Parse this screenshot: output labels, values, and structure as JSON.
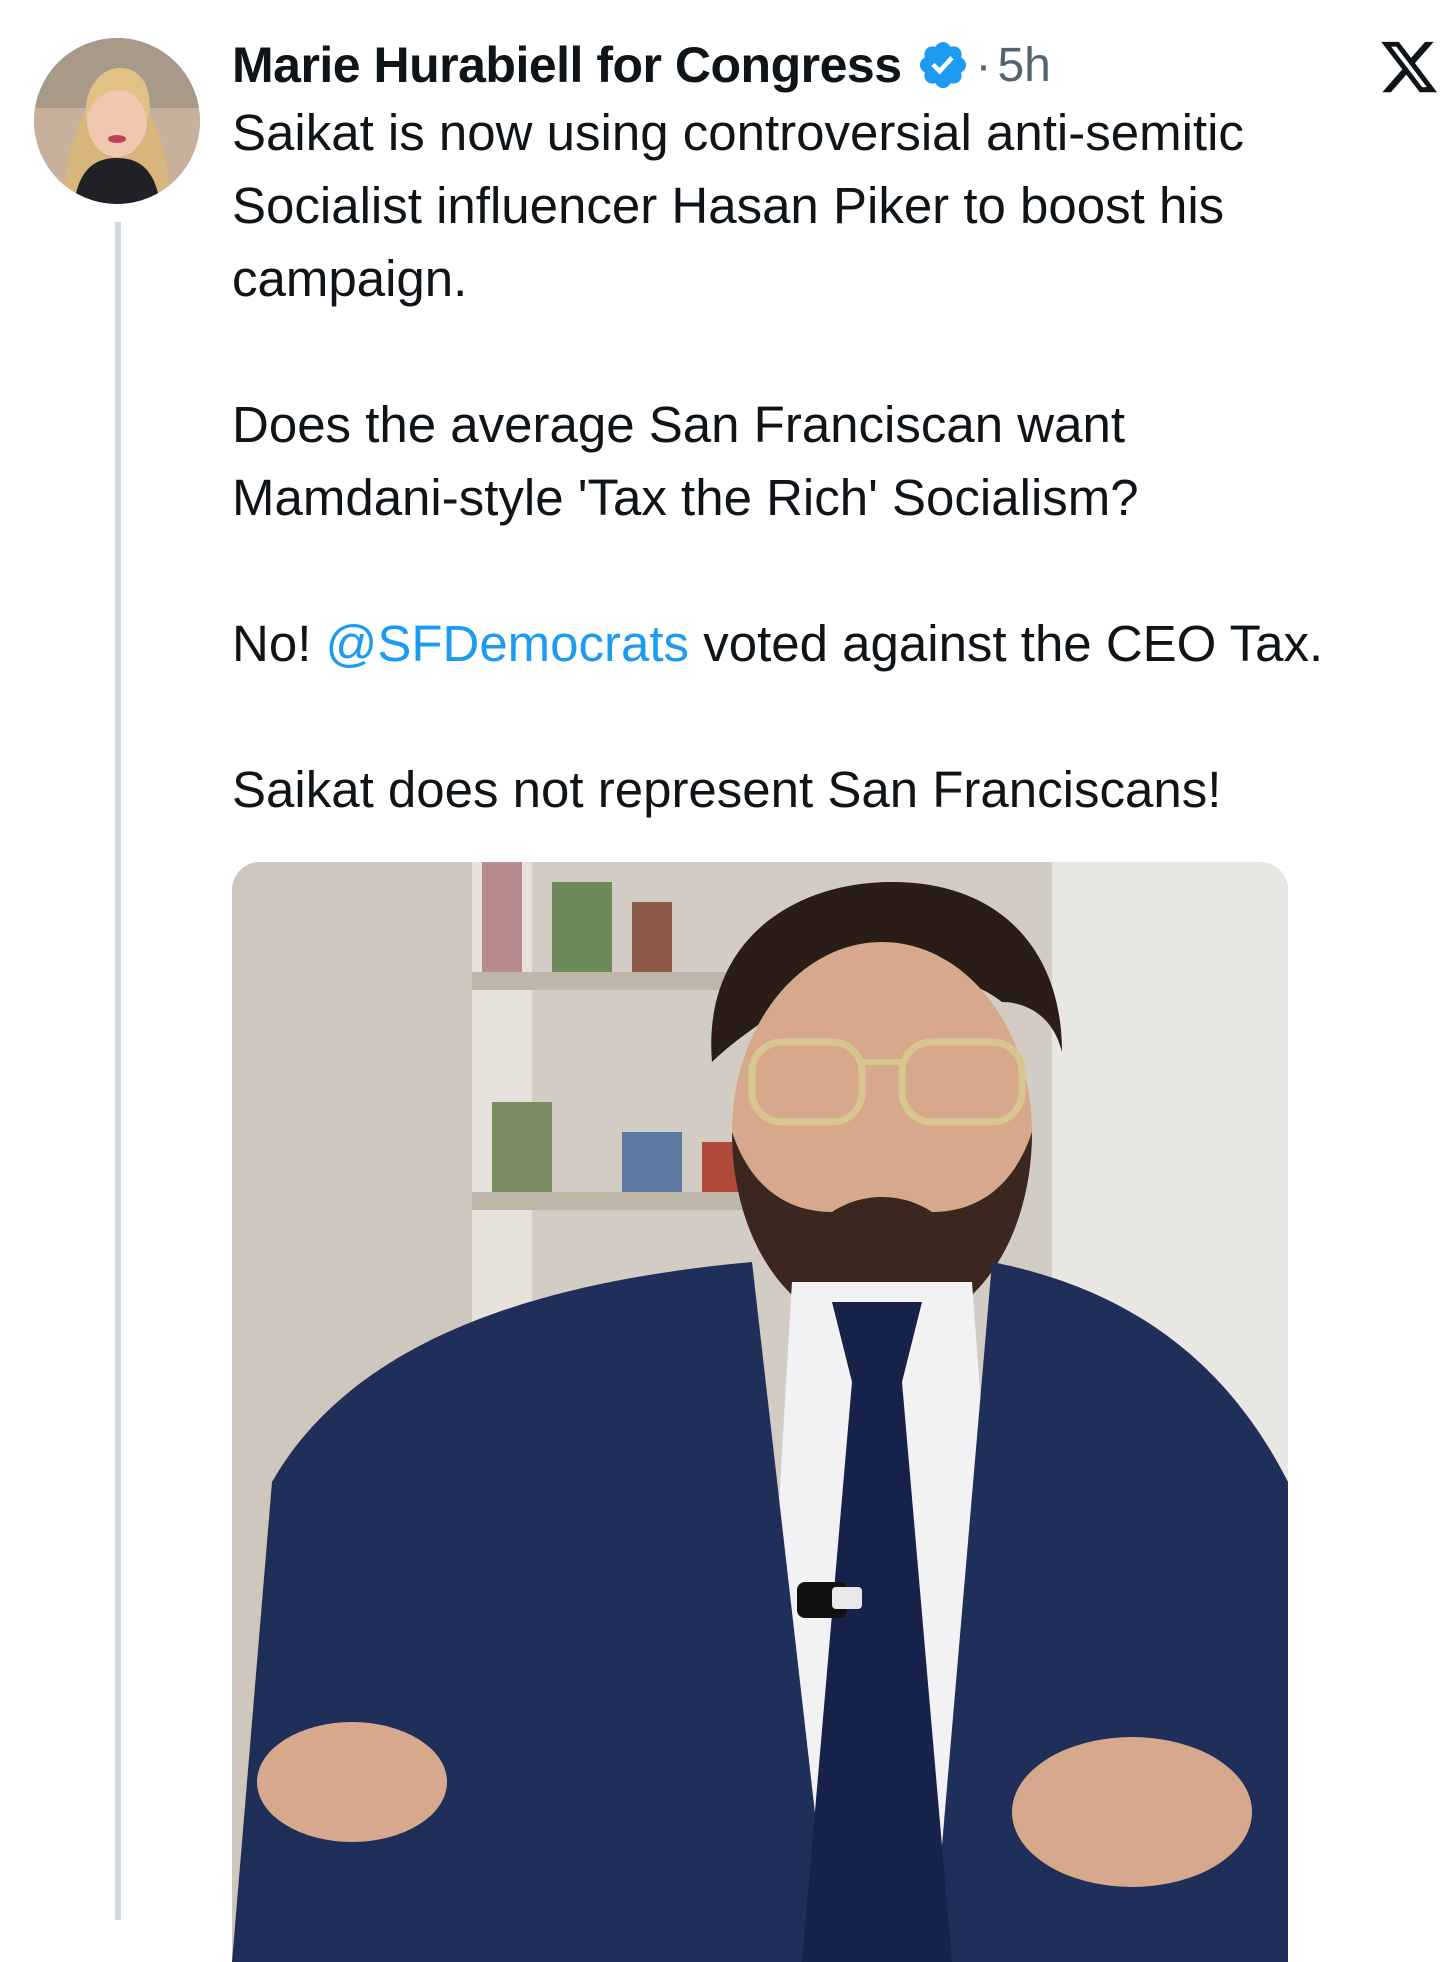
{
  "tweet": {
    "author": {
      "name": "Marie Hurabiell for Congress",
      "verified": true
    },
    "separator": "·",
    "timestamp": "5h",
    "paragraphs": [
      {
        "lines": [
          "Saikat is now using controversial anti-semitic",
          "Socialist influencer Hasan Piker to boost his",
          "campaign."
        ]
      },
      {
        "lines": [
          "Does the average San Franciscan want",
          "Mamdani-style 'Tax the Rich' Socialism?"
        ]
      },
      {
        "prefix": "No! ",
        "mention": "@SFDemocrats",
        "suffix": " voted against the CEO Tax."
      },
      {
        "lines": [
          "Saikat does not represent San Franciscans!"
        ]
      }
    ]
  },
  "icons": {
    "verified": "verified-badge-icon",
    "platform_logo": "x-logo-icon"
  },
  "colors": {
    "text": "#0f1419",
    "secondary": "#536471",
    "accent": "#1d9bf0",
    "thread_line": "#cfd9de"
  }
}
